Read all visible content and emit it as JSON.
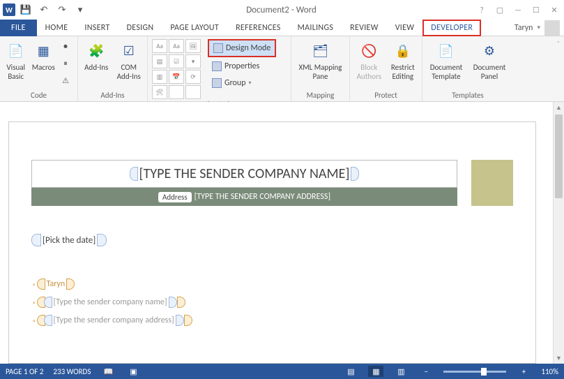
{
  "titlebar": {
    "title": "Document2 - Word"
  },
  "tabs": {
    "file": "FILE",
    "home": "HOME",
    "insert": "INSERT",
    "design": "DESIGN",
    "page_layout": "PAGE LAYOUT",
    "references": "REFERENCES",
    "mailings": "MAILINGS",
    "review": "REVIEW",
    "view": "VIEW",
    "developer": "DEVELOPER"
  },
  "user": {
    "name": "Taryn"
  },
  "ribbon": {
    "groups": {
      "code": {
        "label": "Code",
        "visual_basic": "Visual Basic",
        "macros": "Macros"
      },
      "addins": {
        "label": "Add-Ins",
        "addins": "Add-Ins",
        "com": "COM Add-Ins"
      },
      "controls": {
        "label": "Controls",
        "design_mode": "Design Mode",
        "properties": "Properties",
        "group": "Group"
      },
      "mapping": {
        "label": "Mapping",
        "xml": "XML Mapping Pane"
      },
      "protect": {
        "label": "Protect",
        "block": "Block Authors",
        "restrict": "Restrict Editing"
      },
      "templates": {
        "label": "Templates",
        "doc_template": "Document Template",
        "doc_panel": "Document Panel"
      }
    }
  },
  "document": {
    "title_placeholder": "[TYPE THE SENDER COMPANY NAME]",
    "address_label": "Address",
    "address_placeholder": "[TYPE THE SENDER COMPANY ADDRESS]",
    "date_placeholder": "[Pick the date]",
    "fields": {
      "name": "Taryn",
      "company": "[Type the sender company name]",
      "address2": "[Type the sender company address]"
    }
  },
  "statusbar": {
    "page": "PAGE 1 OF 2",
    "words": "233 WORDS",
    "zoom": "110%"
  }
}
